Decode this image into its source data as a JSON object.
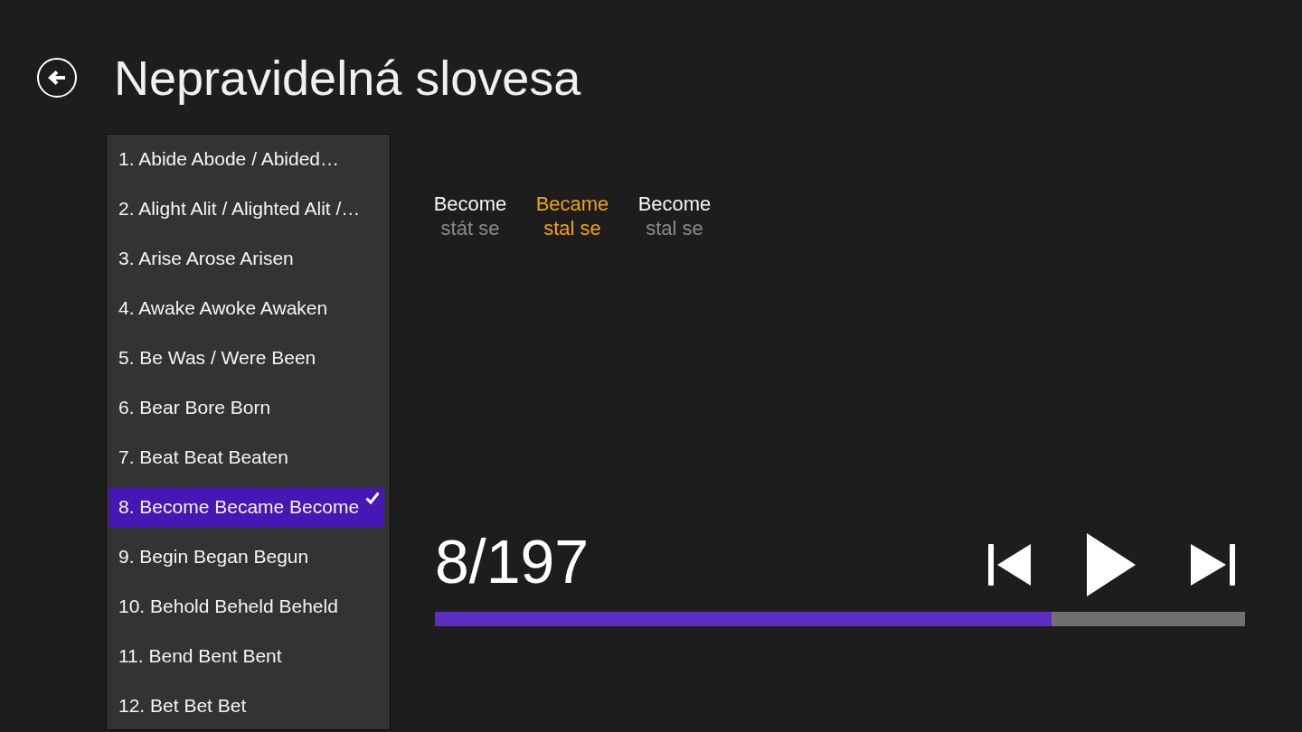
{
  "page": {
    "title": "Nepravidelná slovesa"
  },
  "verb_list": {
    "items": [
      {
        "label": "1. Abide Abode / Abided…",
        "selected": false
      },
      {
        "label": "2. Alight Alit / Alighted Alit /…",
        "selected": false
      },
      {
        "label": "3. Arise Arose Arisen",
        "selected": false
      },
      {
        "label": "4. Awake Awoke Awaken",
        "selected": false
      },
      {
        "label": "5. Be Was / Were Been",
        "selected": false
      },
      {
        "label": "6. Bear Bore Born",
        "selected": false
      },
      {
        "label": "7. Beat Beat Beaten",
        "selected": false
      },
      {
        "label": "8. Become Became Become",
        "selected": true
      },
      {
        "label": "9. Begin Began Begun",
        "selected": false
      },
      {
        "label": "10. Behold Beheld Beheld",
        "selected": false
      },
      {
        "label": "11. Bend Bent Bent",
        "selected": false
      },
      {
        "label": "12. Bet Bet Bet",
        "selected": false
      }
    ]
  },
  "verb_forms": [
    {
      "word": "Become",
      "translation": "stát se",
      "highlighted": false
    },
    {
      "word": "Became",
      "translation": "stal se",
      "highlighted": true
    },
    {
      "word": "Become",
      "translation": "stal se",
      "highlighted": false
    }
  ],
  "player": {
    "counter": "8/197",
    "progress": {
      "level": 0.761
    },
    "controls": [
      {
        "kind": "previous"
      },
      {
        "kind": "play"
      },
      {
        "kind": "next"
      }
    ]
  }
}
